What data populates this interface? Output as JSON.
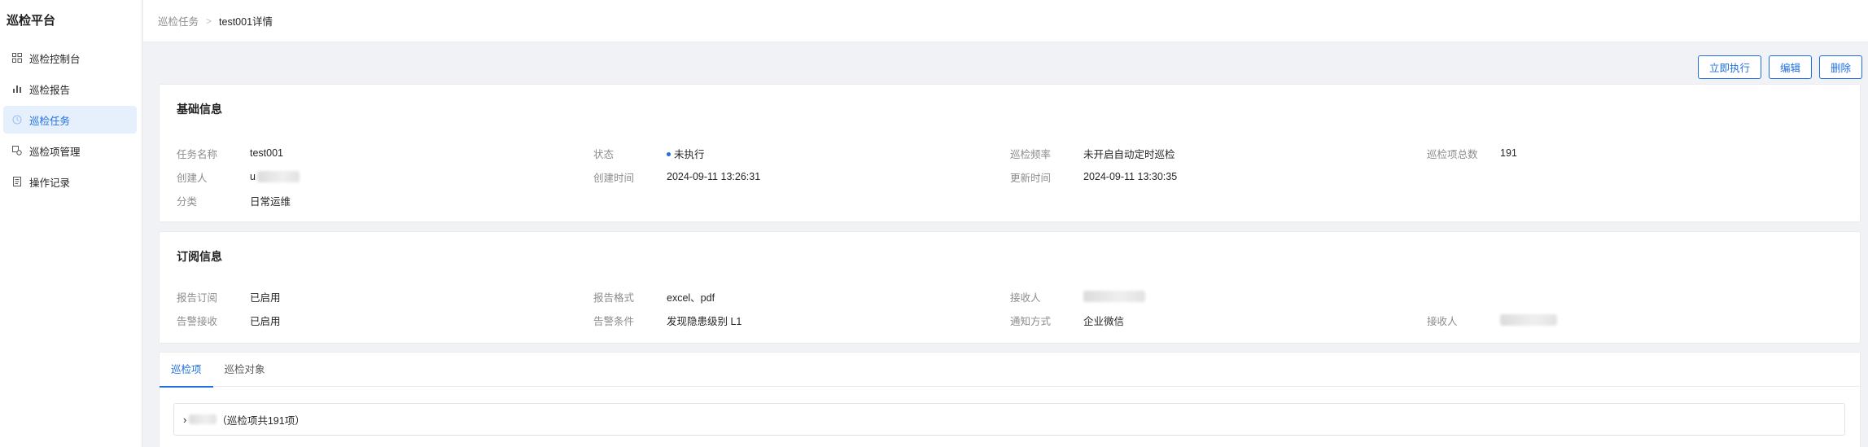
{
  "sidebar": {
    "title": "巡检平台",
    "items": [
      {
        "label": "巡检控制台",
        "icon": "dashboard-icon"
      },
      {
        "label": "巡检报告",
        "icon": "bar-chart-icon"
      },
      {
        "label": "巡检任务",
        "icon": "clock-icon",
        "active": true
      },
      {
        "label": "巡检项管理",
        "icon": "item-manage-icon"
      },
      {
        "label": "操作记录",
        "icon": "log-icon"
      }
    ]
  },
  "header": {
    "breadcrumb_parent": "巡检任务",
    "breadcrumb_separator": ">",
    "breadcrumb_current": "test001详情"
  },
  "actions": {
    "run_now": "立即执行",
    "edit": "编辑",
    "delete": "删除"
  },
  "basic": {
    "title": "基础信息",
    "task_name_label": "任务名称",
    "task_name": "test001",
    "status_label": "状态",
    "status": "未执行",
    "frequency_label": "巡检频率",
    "frequency": "未开启自动定时巡检",
    "total_label": "巡检项总数",
    "total": "191",
    "creator_label": "创建人",
    "creator": "u",
    "created_label": "创建时间",
    "created": "2024-09-11 13:26:31",
    "updated_label": "更新时间",
    "updated": "2024-09-11 13:30:35",
    "category_label": "分类",
    "category": "日常运维"
  },
  "subscription": {
    "title": "订阅信息",
    "report_sub_label": "报告订阅",
    "report_sub": "已启用",
    "report_format_label": "报告格式",
    "report_format": "excel、pdf",
    "receiver_label": "接收人",
    "alert_recv_label": "告警接收",
    "alert_recv": "已启用",
    "alert_cond_label": "告警条件",
    "alert_cond": "发现隐患级别 L1",
    "notify_label": "通知方式",
    "notify": "企业微信",
    "receiver2_label": "接收人"
  },
  "tabs": {
    "items": [
      "巡检项",
      "巡检对象"
    ],
    "active": 0
  },
  "group": {
    "suffix": "（巡检项共191项）"
  },
  "colors": {
    "accent": "#1f6fe0",
    "active_bg": "#e6f0fc"
  }
}
